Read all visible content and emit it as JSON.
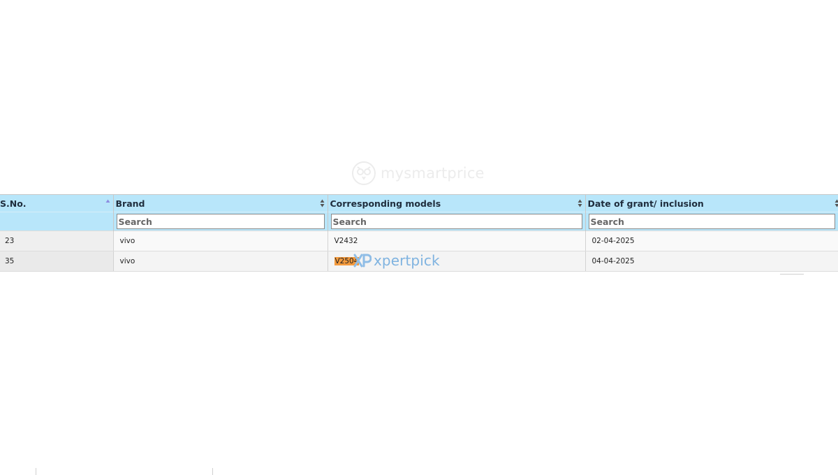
{
  "watermark_top": {
    "text": "mysmartprice",
    "icon": "owl-logo-icon"
  },
  "watermark_bottom": {
    "text": "xpertpick",
    "icon": "xp-logo-icon"
  },
  "table": {
    "columns": [
      {
        "label": "S.No.",
        "sort": "ascending"
      },
      {
        "label": "Brand",
        "sort": "none"
      },
      {
        "label": "Corresponding models",
        "sort": "none"
      },
      {
        "label": "Date of grant/ inclusion",
        "sort": "none"
      }
    ],
    "filters": {
      "brand_placeholder": "Search",
      "models_placeholder": "Search",
      "date_placeholder": "Search"
    },
    "rows": [
      {
        "sno": "23",
        "brand": "vivo",
        "model": "V2432",
        "date": "02-04-2025"
      },
      {
        "sno": "35",
        "brand": "vivo",
        "model": "V2504",
        "date": "04-04-2025"
      }
    ]
  },
  "colors": {
    "header_bg": "#b8e6fa",
    "highlight": "#f39a3d"
  }
}
